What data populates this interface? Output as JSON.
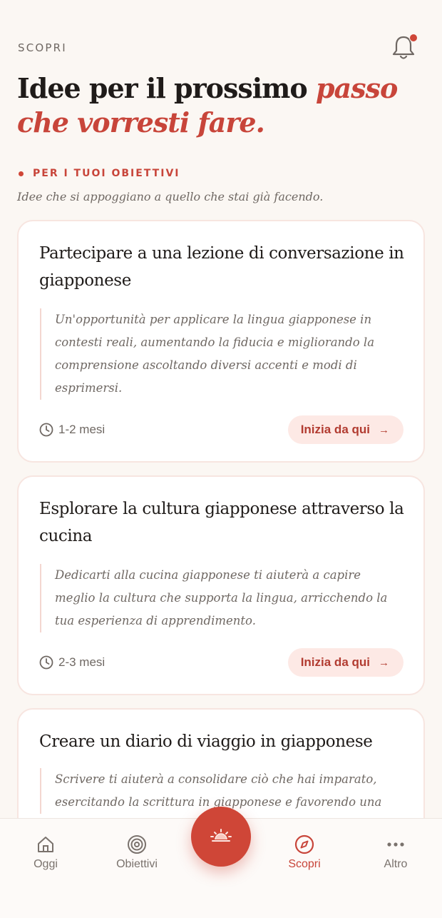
{
  "header": {
    "label": "SCOPRI"
  },
  "title": {
    "main": "Idee per il prossimo ",
    "accent": "passo che vorresti fare."
  },
  "section": {
    "label": "PER I TUOI OBIETTIVI",
    "subtitle": "Idee che si appoggiano a quello che stai già facendo."
  },
  "cards": [
    {
      "title": "Partecipare a una lezione di conversazione in giapponese",
      "description": "Un'opportunità per applicare la lingua giapponese in contesti reali, aumentando la fiducia e migliorando la comprensione ascoltando diversi accenti e modi di esprimersi.",
      "duration": "1-2 mesi",
      "cta": "Inizia da qui"
    },
    {
      "title": "Esplorare la cultura giapponese attraverso la cucina",
      "description": "Dedicarti alla cucina giapponese ti aiuterà a capire meglio la cultura che supporta la lingua, arricchendo la tua esperienza di apprendimento.",
      "duration": "2-3 mesi",
      "cta": "Inizia da qui"
    },
    {
      "title": "Creare un diario di viaggio in giapponese",
      "description": "Scrivere ti aiuterà a consolidare ciò che hai imparato, esercitando la scrittura in giapponese e favorendo una",
      "duration": "",
      "cta": ""
    }
  ],
  "tabs": [
    {
      "label": "Oggi",
      "icon": "home-icon"
    },
    {
      "label": "Obiettivi",
      "icon": "target-icon"
    },
    {
      "label": "Scopri",
      "icon": "compass-icon",
      "active": true
    },
    {
      "label": "Altro",
      "icon": "more-icon"
    }
  ],
  "fab": {
    "icon": "sunrise-icon"
  },
  "colors": {
    "accent": "#c8453a",
    "background": "#fbf7f3",
    "card": "#ffffff",
    "cta_bg": "#fde9e5"
  }
}
